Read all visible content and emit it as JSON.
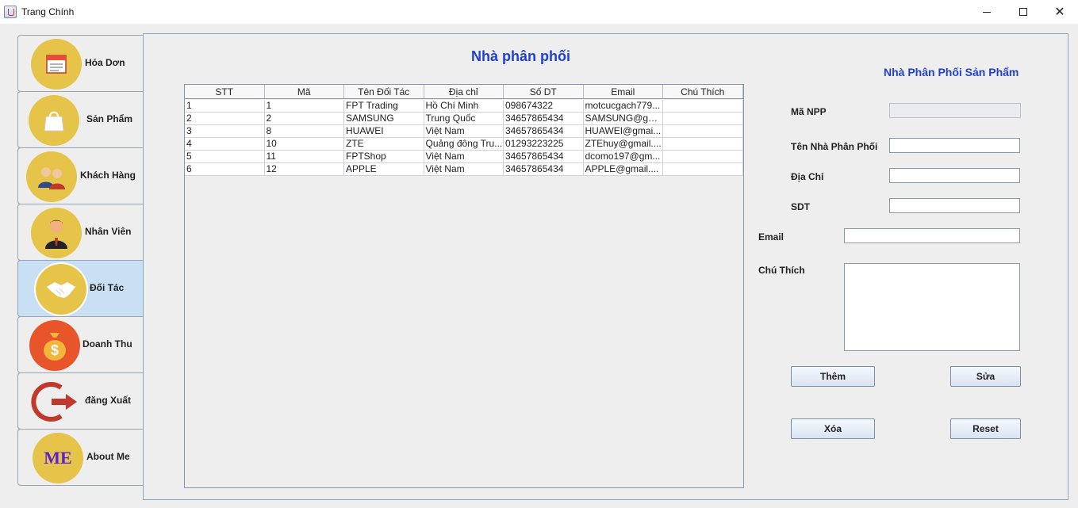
{
  "window": {
    "title": "Trang Chính"
  },
  "sidebar": {
    "items": [
      {
        "label": "Hóa Dơn",
        "icon": "invoice-icon"
      },
      {
        "label": "Sản Phẩm",
        "icon": "shopping-bag-icon"
      },
      {
        "label": "Khách Hàng",
        "icon": "customers-icon"
      },
      {
        "label": "Nhân Viên",
        "icon": "employee-icon"
      },
      {
        "label": "Đối Tác",
        "icon": "handshake-icon"
      },
      {
        "label": "Doanh Thu",
        "icon": "money-bag-icon"
      },
      {
        "label": "đăng Xuất",
        "icon": "logout-icon"
      },
      {
        "label": "About Me",
        "icon": "about-me-icon",
        "icon_text": "ME"
      }
    ],
    "active_index": 4
  },
  "main": {
    "title": "Nhà phân phối",
    "subtitle": "Nhà Phân Phối Sản Phẩm"
  },
  "table": {
    "columns": [
      "STT",
      "Mã",
      "Tên Đối Tác",
      "Địa chỉ",
      "Số DT",
      "Email",
      "Chú Thích"
    ],
    "rows": [
      [
        "1",
        "1",
        "FPT Trading",
        "Hồ Chí Minh",
        "098674322",
        "motcucgach779...",
        ""
      ],
      [
        "2",
        "2",
        "SAMSUNG",
        "Trung Quốc",
        "34657865434",
        "SAMSUNG@gm...",
        ""
      ],
      [
        "3",
        "8",
        "HUAWEI",
        "Việt Nam",
        "34657865434",
        "HUAWEI@gmai...",
        ""
      ],
      [
        "4",
        "10",
        "ZTE",
        "Quảng đông Tru...",
        "01293223225",
        "ZTEhuy@gmail....",
        ""
      ],
      [
        "5",
        "11",
        "FPTShop",
        "Việt Nam",
        "34657865434",
        "dcomo197@gm...",
        ""
      ],
      [
        "6",
        "12",
        "APPLE",
        "Việt Nam",
        "34657865434",
        "APPLE@gmail....",
        ""
      ]
    ]
  },
  "form": {
    "ma_npp_label": "Mã NPP",
    "ma_npp_value": "",
    "ten_label": "Tên Nhà Phân Phối",
    "ten_value": "",
    "dia_chi_label": "Địa Chỉ",
    "dia_chi_value": "",
    "sdt_label": "SDT",
    "sdt_value": "",
    "email_label": "Email",
    "email_value": "",
    "chu_thich_label": "Chú Thích",
    "chu_thich_value": ""
  },
  "buttons": {
    "them": "Thêm",
    "sua": "Sửa",
    "xoa": "Xóa",
    "reset": "Reset"
  },
  "colors": {
    "title_blue": "#1f3fd6",
    "active_nav": "#c9dff3",
    "icon_gold": "#e6c44a"
  }
}
